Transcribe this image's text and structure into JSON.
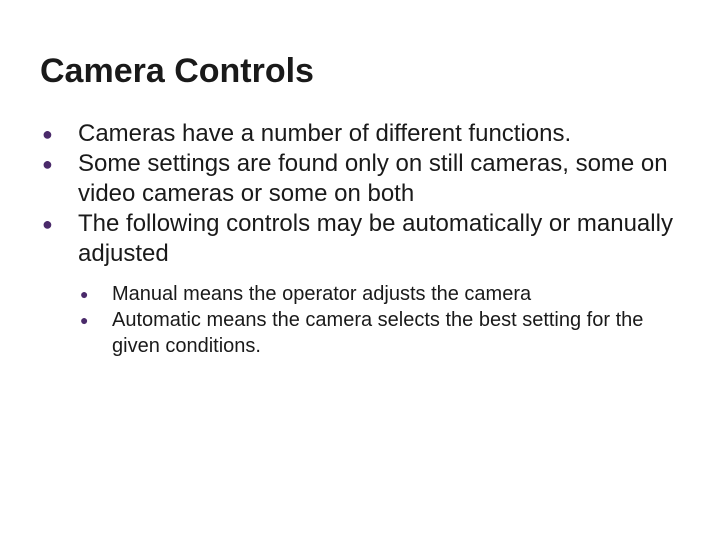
{
  "title": "Camera Controls",
  "items": [
    {
      "text": "Cameras have a number of different functions."
    },
    {
      "text": "Some settings are found only on still cameras, some on video cameras or some on both"
    },
    {
      "text": "The following controls may be automatically or manually adjusted"
    }
  ],
  "subitems": [
    {
      "text": "Manual means the operator adjusts the camera"
    },
    {
      "text": "Automatic means the camera selects the best setting for the given conditions."
    }
  ],
  "bullet": "●"
}
